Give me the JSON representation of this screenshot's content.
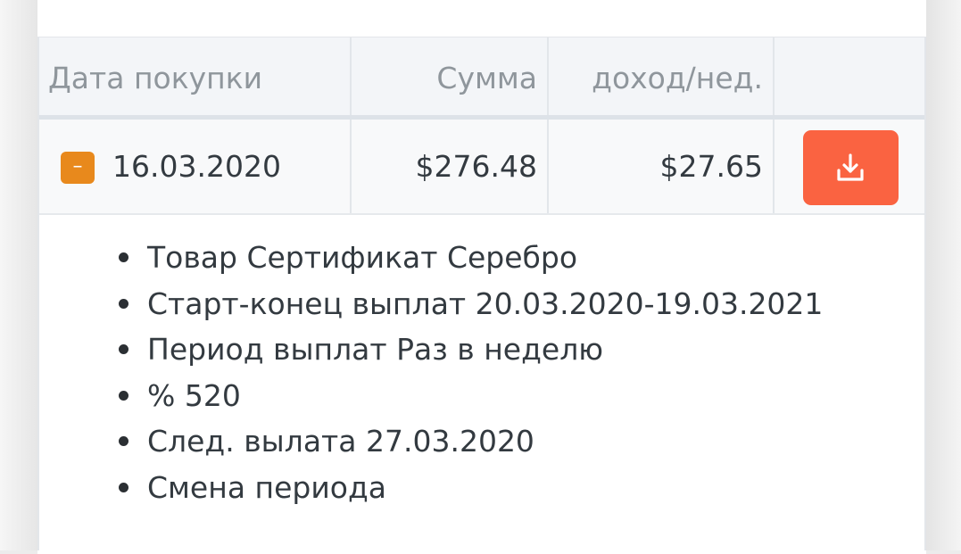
{
  "table": {
    "headers": {
      "date": "Дата покупки",
      "amount": "Сумма",
      "income": "доход/нед."
    },
    "row": {
      "toggle_label": "–",
      "date": "16.03.2020",
      "amount": "$276.48",
      "income": "$27.65",
      "download_icon": "download-icon"
    },
    "details": [
      "Товар Сертификат Серебро",
      "Старт-конец выплат 20.03.2020-19.03.2021",
      "Период выплат Раз в неделю",
      "% 520",
      "След. вылата 27.03.2020",
      "Смена периода"
    ]
  },
  "colors": {
    "toggle": "#e8891c",
    "download_button": "#fa6341",
    "header_bg": "#f3f5f8",
    "header_text": "#8f969c",
    "body_text": "#333a40"
  }
}
